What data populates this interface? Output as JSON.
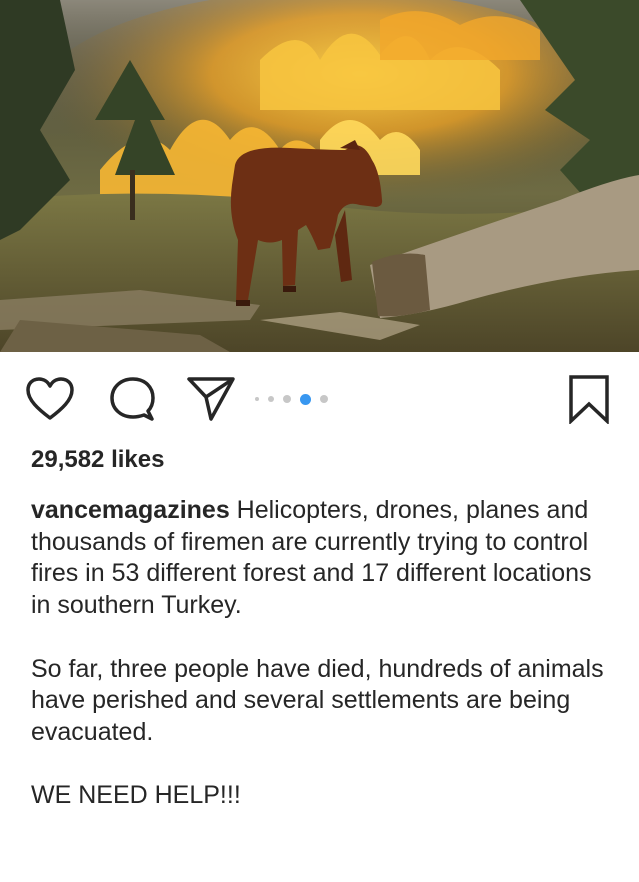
{
  "post": {
    "image_alt": "A brown calf standing in a burning forest",
    "likes_text": "29,582 likes",
    "username": "vancemagazines",
    "caption_paragraphs": [
      "Helicopters, drones, planes and thousands of firemen are currently trying to control fires in 53 different forest and 17 different locations  in southern Turkey.",
      "So far, three people have died, hundreds of animals have perished and several settlements are being evacuated.",
      "WE NEED HELP!!!"
    ]
  },
  "carousel": {
    "slide_count": 5,
    "active_index": 3,
    "active_color": "#3897f0",
    "inactive_color": "#c7c7c7"
  },
  "icons": {
    "like": "heart-icon",
    "comment": "comment-bubble-icon",
    "share": "paper-plane-icon",
    "save": "bookmark-icon"
  }
}
